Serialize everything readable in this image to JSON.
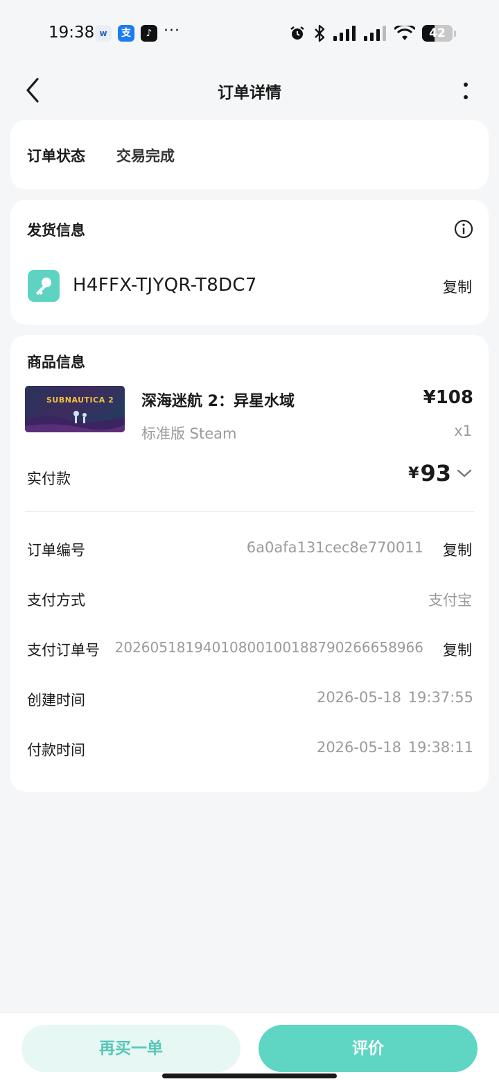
{
  "status_bar": {
    "time": "19:38",
    "more": "···",
    "battery": "42",
    "battery_level": 0.42,
    "icons": [
      "app-icon",
      "alipay-icon",
      "tiktok-icon",
      "alarm-icon",
      "bluetooth-icon",
      "signal-icon",
      "signal-icon",
      "wifi-icon",
      "battery-icon"
    ]
  },
  "nav": {
    "title": "订单详情"
  },
  "order_status": {
    "label": "订单状态",
    "value": "交易完成"
  },
  "delivery": {
    "title": "发货信息",
    "key_code": "H4FFX-TJYQR-T8DC7",
    "copy_label": "复制"
  },
  "goods": {
    "title": "商品信息",
    "thumbnail_logo": "SUBNAUTICA 2",
    "name": "深海迷航 2：异星水域",
    "price": "¥108",
    "edition": "标准版 Steam",
    "quantity": "x1",
    "paid_label": "实付款",
    "paid_currency": "¥",
    "paid_amount": "93"
  },
  "details": {
    "order_no_label": "订单编号",
    "order_no": "6a0afa131cec8e770011",
    "order_no_copy": "复制",
    "pay_method_label": "支付方式",
    "pay_method": "支付宝",
    "pay_order_no_label": "支付订单号",
    "pay_order_no": "2026051819401080010018879026665896​6",
    "pay_order_no_copy": "复制",
    "created_label": "创建时间",
    "created_date": "2026-05-18",
    "created_time": "19:37:55",
    "paid_time_label": "付款时间",
    "paid_date": "2026-05-18",
    "paid_time": "19:38:11"
  },
  "actions": {
    "buy_again": "再买一单",
    "review": "评价"
  },
  "colors": {
    "accent": "#5fd6c4",
    "accent_light": "#e6f7f4",
    "page_bg": "#f5f6f8"
  }
}
